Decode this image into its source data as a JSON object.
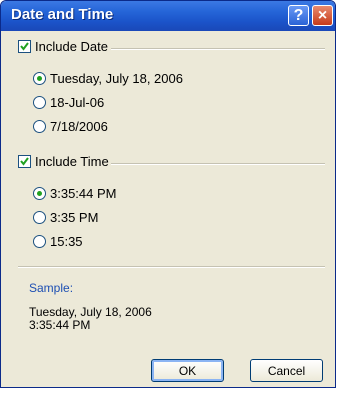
{
  "window": {
    "title": "Date and Time",
    "help_symbol": "?",
    "close_symbol": "×"
  },
  "date": {
    "include_label": "Include Date",
    "include_checked": true,
    "options": [
      {
        "label": "Tuesday, July 18, 2006",
        "selected": true
      },
      {
        "label": "18-Jul-06",
        "selected": false
      },
      {
        "label": "7/18/2006",
        "selected": false
      }
    ]
  },
  "time": {
    "include_label": "Include Time",
    "include_checked": true,
    "options": [
      {
        "label": "3:35:44 PM",
        "selected": true
      },
      {
        "label": "3:35 PM",
        "selected": false
      },
      {
        "label": "15:35",
        "selected": false
      }
    ]
  },
  "sample": {
    "label": "Sample:",
    "line1": "Tuesday, July 18, 2006",
    "line2": "3:35:44 PM"
  },
  "buttons": {
    "ok": "OK",
    "cancel": "Cancel"
  },
  "colors": {
    "title_bar": "#2565d8",
    "dialog_bg": "#ece9d8",
    "sample_label": "#1d4fb3",
    "radio_selected": "#21a121"
  }
}
